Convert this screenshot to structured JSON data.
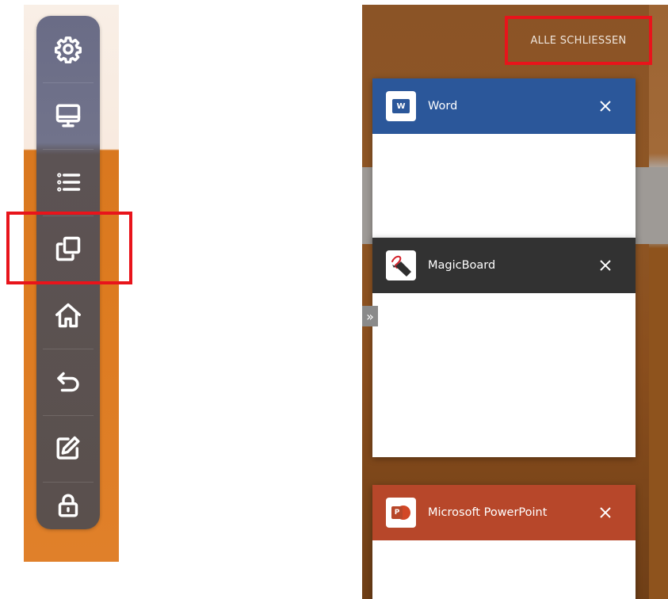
{
  "sidebar": {
    "items": [
      {
        "icon": "gear-icon"
      },
      {
        "icon": "monitor-icon"
      },
      {
        "icon": "list-icon"
      },
      {
        "icon": "windows-icon"
      },
      {
        "icon": "home-icon"
      },
      {
        "icon": "back-icon"
      },
      {
        "icon": "edit-icon"
      },
      {
        "icon": "lock-icon"
      }
    ],
    "highlight_color": "#e8141b"
  },
  "task_view": {
    "close_all_label": "ALLE SCHLIESSEN",
    "expand_glyph": "»",
    "windows": [
      {
        "title": "Word",
        "header_color": "#2b579a",
        "icon": "word-icon",
        "icon_letter": "W"
      },
      {
        "title": "MagicBoard",
        "header_color": "#323232",
        "icon": "magicboard-icon"
      },
      {
        "title": "Microsoft PowerPoint",
        "header_color": "#b7472a",
        "icon": "powerpoint-icon",
        "icon_letter": "P"
      }
    ]
  }
}
